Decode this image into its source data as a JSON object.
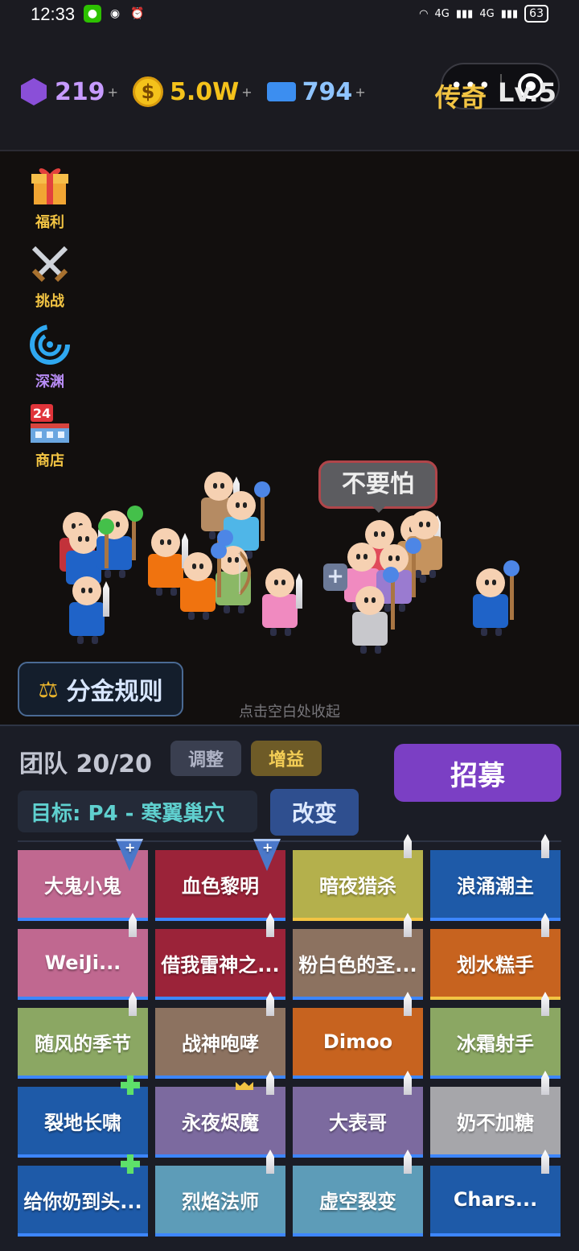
{
  "status_bar": {
    "time": "12:33",
    "network_1": "4G",
    "network_2": "4G",
    "battery": "63"
  },
  "resources": {
    "gems": "219",
    "coins": "5.0W",
    "tickets": "794",
    "plus": "+"
  },
  "rank": {
    "title": "传奇",
    "level": "Lv.5"
  },
  "side_menu": [
    {
      "label": "福利",
      "icon": "gift-icon"
    },
    {
      "label": "挑战",
      "icon": "crossed-swords-icon"
    },
    {
      "label": "深渊",
      "icon": "vortex-icon"
    },
    {
      "label": "商店",
      "icon": "shop-24-icon"
    }
  ],
  "shop_badge": "24",
  "speech_bubble": "不要怕",
  "split_rules_button": "分金规则",
  "tap_hint": "点击空白处收起",
  "team": {
    "label": "团队 20/20",
    "adjust_button": "调整",
    "buff_button": "增益",
    "recruit_button": "招募",
    "target": "目标: P4 - 寒翼巢穴",
    "change_button": "改变"
  },
  "colors": {
    "pink": "#c06890",
    "crimson": "#9b2339",
    "olive": "#b4b04c",
    "blue": "#1e5aa8",
    "brown": "#8c7260",
    "orange": "#c7631f",
    "green": "#8ba763",
    "purple": "#7c6a9f",
    "gray": "#a6a6aa",
    "teal": "#5d9cb8",
    "accent_purple": "#7b3fc4",
    "gold": "#f2c443"
  },
  "members": [
    {
      "name": "大鬼小鬼",
      "color": "pink",
      "badge": "shield",
      "bar": "blue"
    },
    {
      "name": "血色黎明",
      "color": "crimson",
      "badge": "shield",
      "bar": "blue"
    },
    {
      "name": "暗夜猎杀",
      "color": "olive",
      "badge": "pin",
      "bar": "gold"
    },
    {
      "name": "浪涌潮主",
      "color": "blue",
      "badge": "pin",
      "bar": "blue"
    },
    {
      "name": "WeiJi...",
      "color": "pink",
      "badge": "pin",
      "bar": "blue"
    },
    {
      "name": "借我雷神之...",
      "color": "crimson",
      "badge": "pin",
      "bar": "blue"
    },
    {
      "name": "粉白色的圣...",
      "color": "brown",
      "badge": "pin",
      "bar": "blue"
    },
    {
      "name": "划水糕手",
      "color": "orange",
      "badge": "pin",
      "bar": "gold"
    },
    {
      "name": "随风的季节",
      "color": "green",
      "badge": "pin",
      "bar": "blue"
    },
    {
      "name": "战神咆哮",
      "color": "brown",
      "badge": "pin",
      "bar": "blue"
    },
    {
      "name": "Dimoo",
      "color": "orange",
      "badge": "pin",
      "bar": "blue"
    },
    {
      "name": "冰霜射手",
      "color": "green",
      "badge": "pin",
      "bar": "blue"
    },
    {
      "name": "裂地长啸",
      "color": "blue",
      "badge": "plus",
      "bar": "blue"
    },
    {
      "name": "永夜烬魔",
      "color": "purple",
      "badge": "crown-pin",
      "bar": "blue"
    },
    {
      "name": "大表哥",
      "color": "purple",
      "badge": "pin",
      "bar": "blue"
    },
    {
      "name": "奶不加糖",
      "color": "gray",
      "badge": "pin",
      "bar": "blue"
    },
    {
      "name": "给你奶到头...",
      "color": "blue",
      "badge": "plus",
      "bar": "blue"
    },
    {
      "name": "烈焰法师",
      "color": "teal",
      "badge": "pin",
      "bar": "blue"
    },
    {
      "name": "虚空裂变",
      "color": "teal",
      "badge": "pin",
      "bar": "blue"
    },
    {
      "name": "Chars...",
      "color": "blue",
      "badge": "pin",
      "bar": "blue"
    }
  ]
}
